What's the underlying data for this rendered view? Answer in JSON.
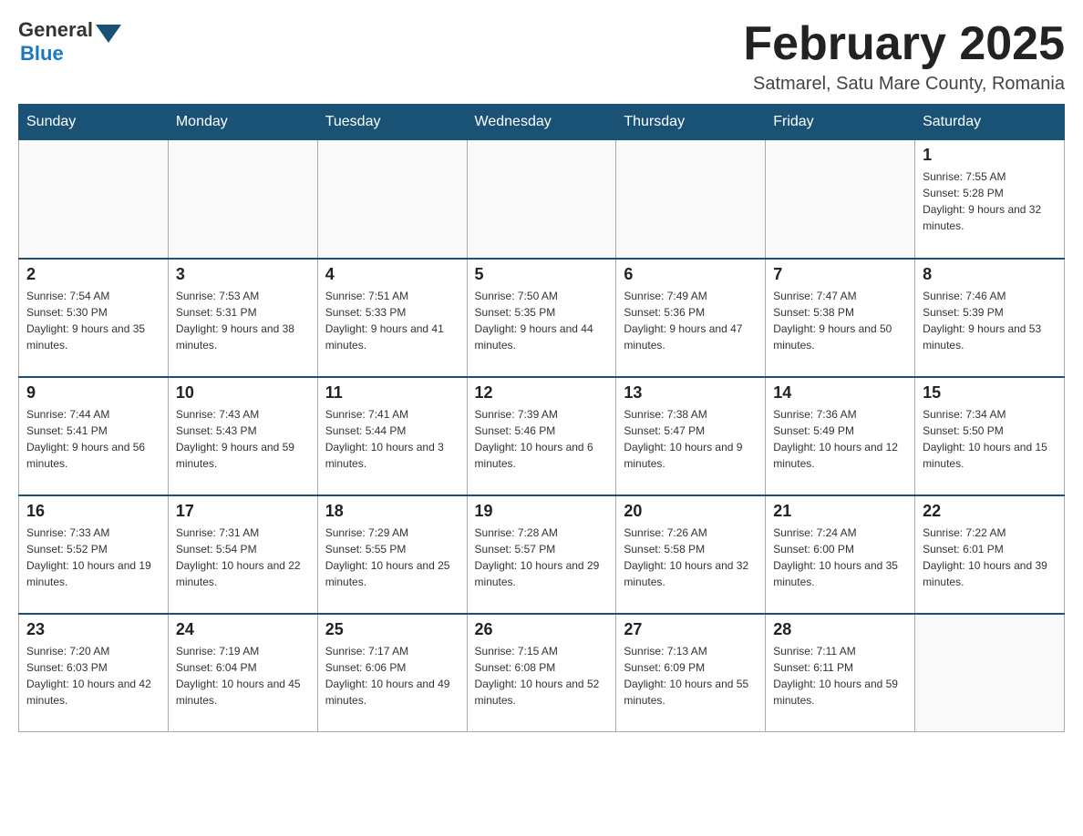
{
  "header": {
    "logo_general": "General",
    "logo_blue": "Blue",
    "month_title": "February 2025",
    "location": "Satmarel, Satu Mare County, Romania"
  },
  "weekdays": [
    "Sunday",
    "Monday",
    "Tuesday",
    "Wednesday",
    "Thursday",
    "Friday",
    "Saturday"
  ],
  "weeks": [
    [
      {
        "day": "",
        "info": ""
      },
      {
        "day": "",
        "info": ""
      },
      {
        "day": "",
        "info": ""
      },
      {
        "day": "",
        "info": ""
      },
      {
        "day": "",
        "info": ""
      },
      {
        "day": "",
        "info": ""
      },
      {
        "day": "1",
        "info": "Sunrise: 7:55 AM\nSunset: 5:28 PM\nDaylight: 9 hours and 32 minutes."
      }
    ],
    [
      {
        "day": "2",
        "info": "Sunrise: 7:54 AM\nSunset: 5:30 PM\nDaylight: 9 hours and 35 minutes."
      },
      {
        "day": "3",
        "info": "Sunrise: 7:53 AM\nSunset: 5:31 PM\nDaylight: 9 hours and 38 minutes."
      },
      {
        "day": "4",
        "info": "Sunrise: 7:51 AM\nSunset: 5:33 PM\nDaylight: 9 hours and 41 minutes."
      },
      {
        "day": "5",
        "info": "Sunrise: 7:50 AM\nSunset: 5:35 PM\nDaylight: 9 hours and 44 minutes."
      },
      {
        "day": "6",
        "info": "Sunrise: 7:49 AM\nSunset: 5:36 PM\nDaylight: 9 hours and 47 minutes."
      },
      {
        "day": "7",
        "info": "Sunrise: 7:47 AM\nSunset: 5:38 PM\nDaylight: 9 hours and 50 minutes."
      },
      {
        "day": "8",
        "info": "Sunrise: 7:46 AM\nSunset: 5:39 PM\nDaylight: 9 hours and 53 minutes."
      }
    ],
    [
      {
        "day": "9",
        "info": "Sunrise: 7:44 AM\nSunset: 5:41 PM\nDaylight: 9 hours and 56 minutes."
      },
      {
        "day": "10",
        "info": "Sunrise: 7:43 AM\nSunset: 5:43 PM\nDaylight: 9 hours and 59 minutes."
      },
      {
        "day": "11",
        "info": "Sunrise: 7:41 AM\nSunset: 5:44 PM\nDaylight: 10 hours and 3 minutes."
      },
      {
        "day": "12",
        "info": "Sunrise: 7:39 AM\nSunset: 5:46 PM\nDaylight: 10 hours and 6 minutes."
      },
      {
        "day": "13",
        "info": "Sunrise: 7:38 AM\nSunset: 5:47 PM\nDaylight: 10 hours and 9 minutes."
      },
      {
        "day": "14",
        "info": "Sunrise: 7:36 AM\nSunset: 5:49 PM\nDaylight: 10 hours and 12 minutes."
      },
      {
        "day": "15",
        "info": "Sunrise: 7:34 AM\nSunset: 5:50 PM\nDaylight: 10 hours and 15 minutes."
      }
    ],
    [
      {
        "day": "16",
        "info": "Sunrise: 7:33 AM\nSunset: 5:52 PM\nDaylight: 10 hours and 19 minutes."
      },
      {
        "day": "17",
        "info": "Sunrise: 7:31 AM\nSunset: 5:54 PM\nDaylight: 10 hours and 22 minutes."
      },
      {
        "day": "18",
        "info": "Sunrise: 7:29 AM\nSunset: 5:55 PM\nDaylight: 10 hours and 25 minutes."
      },
      {
        "day": "19",
        "info": "Sunrise: 7:28 AM\nSunset: 5:57 PM\nDaylight: 10 hours and 29 minutes."
      },
      {
        "day": "20",
        "info": "Sunrise: 7:26 AM\nSunset: 5:58 PM\nDaylight: 10 hours and 32 minutes."
      },
      {
        "day": "21",
        "info": "Sunrise: 7:24 AM\nSunset: 6:00 PM\nDaylight: 10 hours and 35 minutes."
      },
      {
        "day": "22",
        "info": "Sunrise: 7:22 AM\nSunset: 6:01 PM\nDaylight: 10 hours and 39 minutes."
      }
    ],
    [
      {
        "day": "23",
        "info": "Sunrise: 7:20 AM\nSunset: 6:03 PM\nDaylight: 10 hours and 42 minutes."
      },
      {
        "day": "24",
        "info": "Sunrise: 7:19 AM\nSunset: 6:04 PM\nDaylight: 10 hours and 45 minutes."
      },
      {
        "day": "25",
        "info": "Sunrise: 7:17 AM\nSunset: 6:06 PM\nDaylight: 10 hours and 49 minutes."
      },
      {
        "day": "26",
        "info": "Sunrise: 7:15 AM\nSunset: 6:08 PM\nDaylight: 10 hours and 52 minutes."
      },
      {
        "day": "27",
        "info": "Sunrise: 7:13 AM\nSunset: 6:09 PM\nDaylight: 10 hours and 55 minutes."
      },
      {
        "day": "28",
        "info": "Sunrise: 7:11 AM\nSunset: 6:11 PM\nDaylight: 10 hours and 59 minutes."
      },
      {
        "day": "",
        "info": ""
      }
    ]
  ]
}
